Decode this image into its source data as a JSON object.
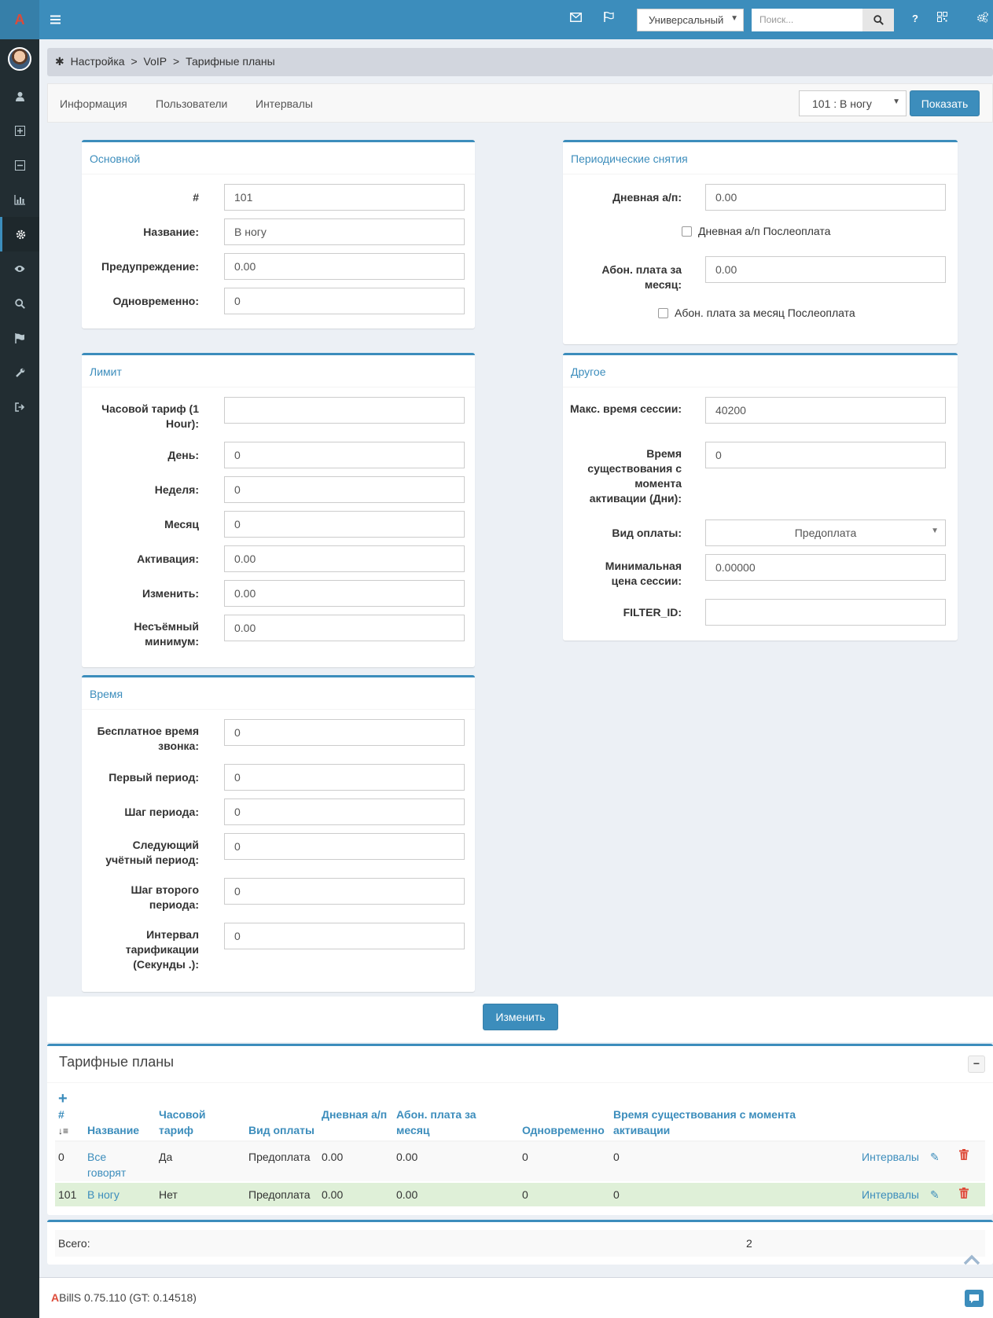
{
  "header": {
    "logo": "A",
    "mode_select": "Универсальный",
    "search_placeholder": "Поиск...",
    "help_icon": "?"
  },
  "breadcrumb": {
    "items": [
      "Настройка",
      "VoIP",
      "Тарифные планы"
    ],
    "separator": ">"
  },
  "nav": {
    "tabs": [
      "Информация",
      "Пользователи",
      "Интервалы"
    ],
    "tp_select": "101 : В ногу",
    "show_button": "Показать"
  },
  "box_main": {
    "title": "Основной",
    "fields": [
      {
        "label": "#",
        "value": "101"
      },
      {
        "label": "Название:",
        "value": "В ногу"
      },
      {
        "label": "Предупреждение:",
        "value": "0.00"
      },
      {
        "label": "Одновременно:",
        "value": "0"
      }
    ]
  },
  "box_periodic": {
    "title": "Периодические снятия",
    "day_fee_label": "Дневная а/п:",
    "day_fee_value": "0.00",
    "day_fee_postpaid": "Дневная а/п Послеоплата",
    "month_fee_label": "Абон. плата за месяц:",
    "month_fee_value": "0.00",
    "month_fee_postpaid": "Абон. плата за месяц Послеоплата"
  },
  "box_limit": {
    "title": "Лимит",
    "fields": [
      {
        "label": "Часовой тариф (1 Hour):",
        "value": ""
      },
      {
        "label": "День:",
        "value": "0"
      },
      {
        "label": "Неделя:",
        "value": "0"
      },
      {
        "label": "Месяц",
        "value": "0"
      },
      {
        "label": "Активация:",
        "value": "0.00"
      },
      {
        "label": "Изменить:",
        "value": "0.00"
      },
      {
        "label": "Несъёмный минимум:",
        "value": "0.00"
      }
    ]
  },
  "box_other": {
    "title": "Другое",
    "max_session_label": "Макс. время сессии:",
    "max_session_value": "40200",
    "age_label": "Время существования с момента активации (Дни):",
    "age_value": "0",
    "payment_type_label": "Вид оплаты:",
    "payment_type_value": "Предоплата",
    "min_price_label": "Минимальная цена сессии:",
    "min_price_value": "0.00000",
    "filter_label": "FILTER_ID:",
    "filter_value": ""
  },
  "box_time": {
    "title": "Время",
    "fields": [
      {
        "label": "Бесплатное время звонка:",
        "value": "0"
      },
      {
        "label": "Первый период:",
        "value": "0"
      },
      {
        "label": "Шаг периода:",
        "value": "0"
      },
      {
        "label": "Следующий учётный период:",
        "value": "0"
      },
      {
        "label": "Шаг второго периода:",
        "value": "0"
      },
      {
        "label": "Интервал тарификации (Секунды .):",
        "value": "0"
      }
    ]
  },
  "submit_button": "Изменить",
  "table": {
    "title": "Тарифные планы",
    "collapse": "−",
    "add": "+",
    "headers": [
      "#",
      "Название",
      "Часовой тариф",
      "Вид оплаты",
      "Дневная а/п",
      "Абон. плата за месяц",
      "Одновременно",
      "Время существования с момента активации"
    ],
    "rows": [
      {
        "id": "0",
        "name": "Все говорят",
        "hourly": "Да",
        "payment": "Предоплата",
        "day_fee": "0.00",
        "month_fee": "0.00",
        "simultaneous": "0",
        "age": "0",
        "intervals": "Интервалы"
      },
      {
        "id": "101",
        "name": "В ногу",
        "hourly": "Нет",
        "payment": "Предоплата",
        "day_fee": "0.00",
        "month_fee": "0.00",
        "simultaneous": "0",
        "age": "0",
        "intervals": "Интервалы"
      }
    ]
  },
  "summary": {
    "label": "Всего:",
    "value": "2"
  },
  "footer": {
    "brand_a": "A",
    "brand_rest": "BillS 0.75.110 (GT: 0.14518)"
  }
}
